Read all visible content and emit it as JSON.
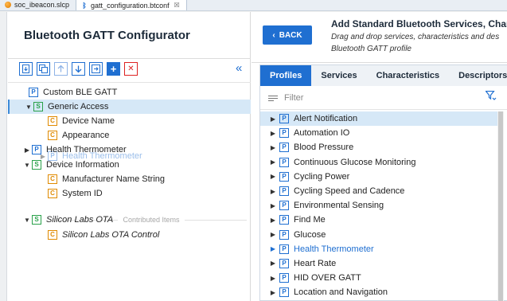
{
  "editor_tabs": [
    {
      "label": "soc_ibeacon.slcp"
    },
    {
      "label": "gatt_configuration.btconf",
      "close": "☒"
    }
  ],
  "left": {
    "title": "Bluetooth GATT Configurator",
    "collapse_glyph": "«",
    "tree": [
      {
        "label": "Custom BLE GATT",
        "type": "P"
      },
      {
        "label": "Generic Access",
        "type": "S"
      },
      {
        "label": "Device Name",
        "type": "C"
      },
      {
        "label": "Appearance",
        "type": "C"
      },
      {
        "label": "Health Thermometer",
        "type": "P"
      },
      {
        "label": "Device Information",
        "type": "S"
      },
      {
        "label": "Manufacturer Name String",
        "type": "C"
      },
      {
        "label": "System ID",
        "type": "C"
      },
      {
        "label": "Silicon Labs OTA",
        "type": "S"
      },
      {
        "label": "Silicon Labs OTA Control",
        "type": "C"
      }
    ],
    "drag_ghost": "Health Thermometer",
    "contributed_label": "Contributed Items"
  },
  "right": {
    "back_label": "BACK",
    "title": "Add Standard Bluetooth Services, Charac",
    "subtitle": "Drag and drop services, characteristics and des Bluetooth GATT profile",
    "tabs": [
      "Profiles",
      "Services",
      "Characteristics",
      "Descriptors"
    ],
    "filter_placeholder": "Filter",
    "profiles": [
      "Alert Notification",
      "Automation IO",
      "Blood Pressure",
      "Continuous Glucose Monitoring",
      "Cycling Power",
      "Cycling Speed and Cadence",
      "Environmental Sensing",
      "Find Me",
      "Glucose",
      "Health Thermometer",
      "Heart Rate",
      "HID OVER GATT",
      "Location and Navigation"
    ]
  },
  "colors": {
    "accent": "#1f6fd1",
    "service_green": "#2aa14a",
    "characteristic_orange": "#e08a00",
    "selection": "#d6e8f7"
  }
}
